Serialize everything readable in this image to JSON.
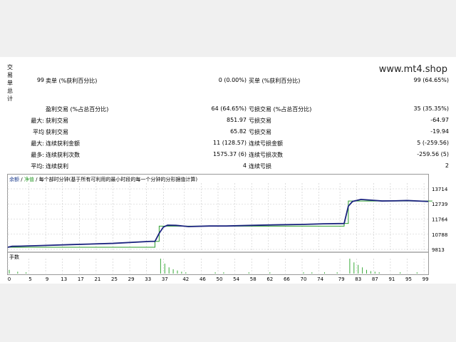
{
  "report": {
    "side_label": [
      "交",
      "易",
      "单",
      "总",
      "计"
    ],
    "site": "www.mt4.shop",
    "rows": [
      {
        "c1": "99",
        "c2": "卖单 (%获利百分比)",
        "c3": "0 (0.00%)",
        "c4": "买单 (%获利百分比)",
        "c5": "99 (64.65%)"
      },
      {
        "c1": "",
        "c2": "",
        "c3": "",
        "c4": "",
        "c5": ""
      },
      {
        "c1": "",
        "c2": "盈利交易 (%占总百分比)",
        "c3": "64 (64.65%)",
        "c4": "亏损交易 (%占总百分比)",
        "c5": "35 (35.35%)"
      },
      {
        "c1": "最大:",
        "c2": "获利交易",
        "c3": "851.97",
        "c4": "亏损交易",
        "c5": "-64.97"
      },
      {
        "c1": "平均",
        "c2": "获利交易",
        "c3": "65.82",
        "c4": "亏损交易",
        "c5": "-19.94"
      },
      {
        "c1": "最大:",
        "c2": "连续获利金额",
        "c3": "11 (128.57)",
        "c4": "连续亏损金额",
        "c5": "5 (-259.56)"
      },
      {
        "c1": "最多:",
        "c2": "连续获利次数",
        "c3": "1575.37 (6)",
        "c4": "连续亏损次数",
        "c5": "-259.56 (5)"
      },
      {
        "c1": "平均:",
        "c2": "连续获利",
        "c3": "4",
        "c4": "连续亏损",
        "c5": "2"
      }
    ]
  },
  "chart": {
    "legend_balance": "余额",
    "legend_sep": "/",
    "legend_equity": "净值",
    "legend_desc": "/ 每个部时分钟(基于所有可利用的最小时段的每一个分钟的分形据值计算)",
    "volume_label": "手数",
    "colors": {
      "balance": "#1a237e",
      "equity": "#2e9e2e",
      "volume": "#3aaa3a",
      "grid": "#c8c8c8"
    }
  },
  "chart_data": {
    "type": "line",
    "y_ticks": [
      13714,
      12739,
      11764,
      10788,
      9813
    ],
    "ylim": [
      9813,
      13714
    ],
    "x_ticks": [
      0,
      5,
      9,
      13,
      17,
      21,
      25,
      29,
      33,
      37,
      42,
      46,
      50,
      54,
      58,
      62,
      66,
      70,
      74,
      79,
      83,
      87,
      91,
      95,
      99
    ],
    "xlim": [
      0,
      100
    ],
    "series": [
      {
        "name": "余额",
        "x": [
          0,
          1,
          3,
          8,
          15,
          25,
          34,
          35,
          36,
          37,
          38,
          40,
          43,
          48,
          52,
          58,
          65,
          70,
          75,
          80,
          81,
          82,
          84,
          86,
          89,
          92,
          95,
          99,
          101
        ],
        "y": [
          9950,
          10010,
          10020,
          10060,
          10120,
          10200,
          10330,
          10330,
          10850,
          11250,
          11370,
          11360,
          11280,
          11320,
          11320,
          11360,
          11400,
          11420,
          11460,
          11480,
          12600,
          12900,
          13030,
          12990,
          12930,
          12940,
          12960,
          12910,
          12900
        ]
      },
      {
        "name": "净值",
        "x": [
          0,
          35,
          36,
          80,
          81,
          101
        ],
        "y": [
          9950,
          10330,
          11310,
          11480,
          12930,
          12930
        ]
      }
    ],
    "volume": {
      "x": [
        0,
        2,
        4,
        36,
        37,
        38,
        39,
        40,
        41,
        42,
        49,
        51,
        57,
        62,
        70,
        72,
        75,
        78,
        81,
        82,
        83,
        84,
        85,
        86,
        87,
        88,
        93,
        97
      ],
      "v": [
        6,
        3,
        2,
        24,
        16,
        10,
        7,
        5,
        3,
        2,
        2,
        2,
        2,
        2,
        2,
        2,
        2,
        2,
        24,
        18,
        14,
        10,
        6,
        4,
        3,
        2,
        2,
        2
      ]
    }
  }
}
